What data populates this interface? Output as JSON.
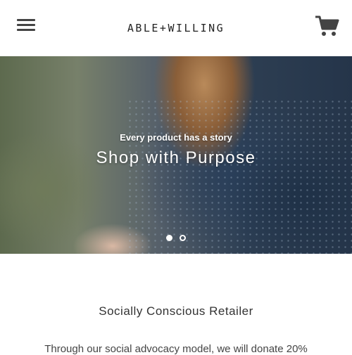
{
  "header": {
    "menu_icon": "hamburger-menu-icon",
    "logo_text": "ABLE+WILLING",
    "cart_icon": "shopping-cart-icon"
  },
  "hero": {
    "subtitle": "Every product has a story",
    "title": "Shop with Purpose",
    "slides": {
      "total": 2,
      "active": 1
    }
  },
  "content": {
    "heading": "Socially Conscious Retailer",
    "body_partial": "Through our social advocacy model, we will donate 20%"
  },
  "colors": {
    "header_bg": "#ffffff",
    "text_dark": "#333333",
    "hero_text": "#ffffff"
  }
}
